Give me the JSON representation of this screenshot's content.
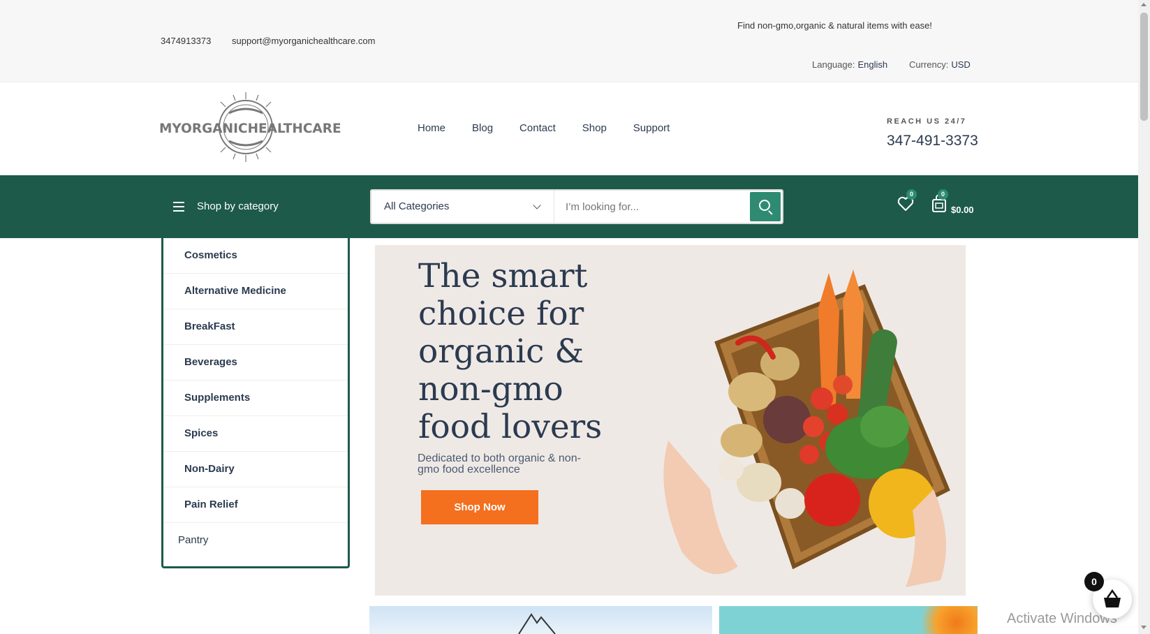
{
  "topbar": {
    "phone": "3474913373",
    "email": "support@myorganichealthcare.com",
    "promo": "Find non-gmo,organic & natural items with ease!",
    "language_label": "Language:",
    "language_value": "English",
    "currency_label": "Currency:",
    "currency_value": "USD"
  },
  "header": {
    "logo_text": "MYORGANICHEALTHCARE",
    "nav": [
      "Home",
      "Blog",
      "Contact",
      "Shop",
      "Support"
    ],
    "reach_label": "REACH US 24/7",
    "hotline": "347-491-3373"
  },
  "toolbar": {
    "shop_by_category": "Shop by category",
    "category_select": "All Categories",
    "search_placeholder": "I’m looking for...",
    "wishlist_count": "0",
    "cart_count": "0",
    "cart_total": "$0.00"
  },
  "categories": [
    "Cosmetics",
    "Alternative Medicine",
    "BreakFast",
    "Beverages",
    "Supplements",
    "Spices",
    "Non-Dairy",
    "Pain Relief",
    "Pantry"
  ],
  "hero": {
    "headline": "The smart choice for organic & non-gmo food lovers",
    "subtitle": "Dedicated to both organic & non-gmo food excellence",
    "cta": "Shop Now"
  },
  "floating_cart": {
    "count": "0"
  },
  "os_overlay": {
    "activate": "Activate Windows"
  },
  "colors": {
    "brand_green": "#1d5a4a",
    "accent_green": "#2e8b72",
    "cta_orange": "#f46f1e",
    "text_navy": "#2b3a4f"
  }
}
